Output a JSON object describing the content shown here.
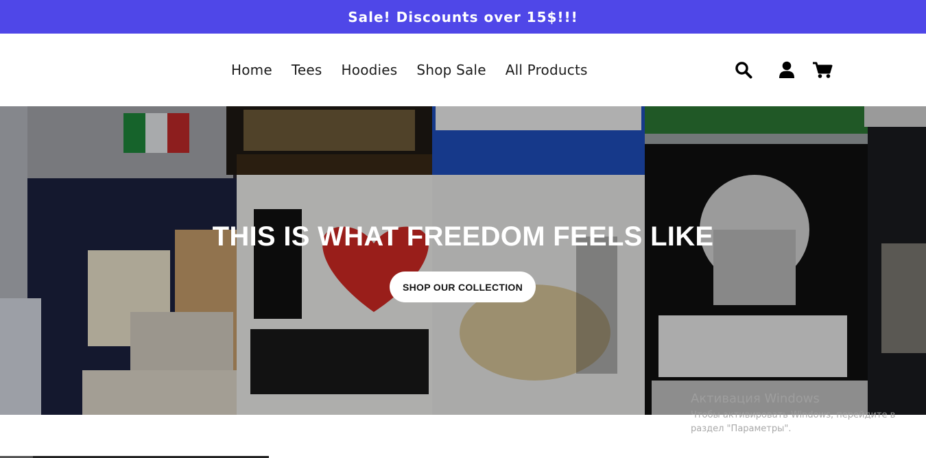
{
  "announcement": {
    "text": "Sale! Discounts over 15$!!!",
    "background": "#4f47e8"
  },
  "nav": {
    "items": [
      {
        "label": "Home"
      },
      {
        "label": "Tees"
      },
      {
        "label": "Hoodies"
      },
      {
        "label": "Shop Sale"
      },
      {
        "label": "All Products"
      }
    ]
  },
  "header_icons": [
    "search-icon",
    "account-icon",
    "cart-icon"
  ],
  "hero": {
    "title": "THIS IS WHAT FREEDOM FEELS LIKE",
    "cta_label": "SHOP OUR COLLECTION"
  },
  "windows_watermark": {
    "title": "Активация Windows",
    "subtitle": "Чтобы активировать Windows, перейдите в раздел \"Параметры\"."
  }
}
